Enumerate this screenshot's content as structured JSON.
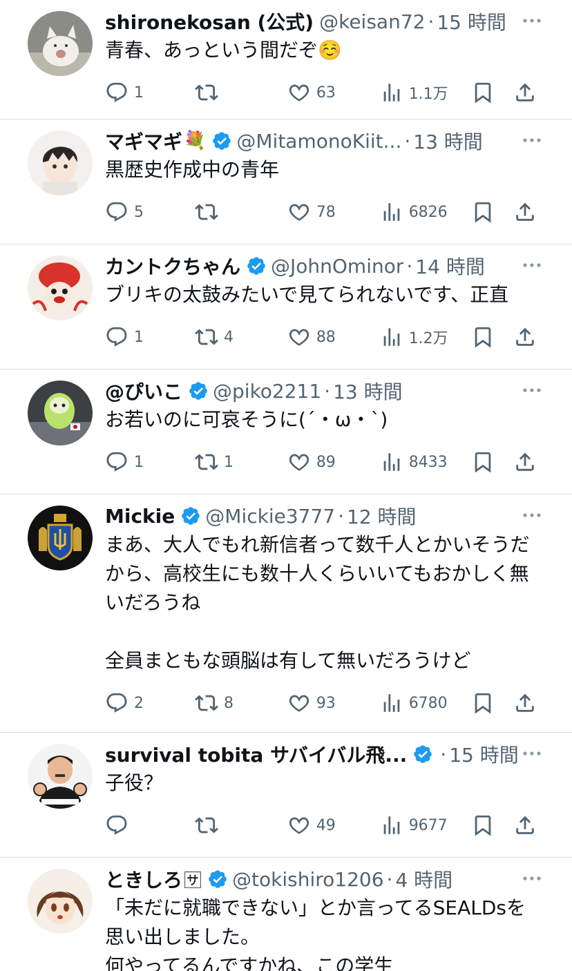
{
  "tweets": [
    {
      "name": "shironekosan (公式)",
      "name_emoji": "",
      "verified": false,
      "handle": "@keisan72",
      "time": "15 時間",
      "text": "青春、あっという間だぞ☺️",
      "replies": "1",
      "retweets": "",
      "likes": "63",
      "views": "1.1万",
      "avatar": "white-cat-avatar"
    },
    {
      "name": "マギマギ",
      "name_emoji": "💐",
      "verified": true,
      "handle": "@MitamonoKiit...",
      "time": "13 時間",
      "text": "黒歴史作成中の青年",
      "replies": "5",
      "retweets": "",
      "likes": "78",
      "views": "6826",
      "avatar": "anime-boy-avatar"
    },
    {
      "name": "カントクちゃん",
      "name_emoji": "",
      "verified": true,
      "handle": "@JohnOminor",
      "time": "14 時間",
      "text": "ブリキの太鼓みたいで見てられないです、正直",
      "replies": "1",
      "retweets": "4",
      "likes": "88",
      "views": "1.2万",
      "avatar": "red-character-avatar"
    },
    {
      "name": "@ぴいこ",
      "name_emoji": "",
      "verified": true,
      "handle": "@piko2211",
      "time": "13 時間",
      "text": "お若いのに可哀そうに(´・ω・`)",
      "replies": "1",
      "retweets": "1",
      "likes": "89",
      "views": "8433",
      "avatar": "green-parakeet-avatar"
    },
    {
      "name": "Mickie",
      "name_emoji": "",
      "verified": true,
      "handle": "@Mickie3777",
      "time": "12 時間",
      "text": "まあ、大人でもれ新信者って数千人とかいそうだから、高校生にも数十人くらいいてもおかしく無いだろうね\n\n全員まともな頭脳は有して無いだろうけど",
      "replies": "2",
      "retweets": "8",
      "likes": "93",
      "views": "6780",
      "avatar": "ukraine-coat-of-arms-avatar"
    },
    {
      "name": "survival tobita サバイバル飛...",
      "name_emoji": "",
      "verified": true,
      "handle": "",
      "time": "15 時間",
      "text": "子役？",
      "replies": "",
      "retweets": "",
      "likes": "49",
      "views": "9677",
      "avatar": "cartoon-man-avatar"
    },
    {
      "name": "ときしろ",
      "name_emoji": "🈂",
      "verified": true,
      "handle": "@tokishiro1206",
      "time": "4 時間",
      "text": "「未だに就職できない」とか言ってるSEALDsを思い出しました。\n何やってるんですかね、この学生",
      "replies": "",
      "retweets": "",
      "likes": "",
      "views": "",
      "avatar": "anime-girl-avatar"
    }
  ],
  "dot": "·",
  "more_glyph": "···",
  "colors": {
    "verified": "#1d9bf0",
    "secondary": "#536471",
    "divider": "#dadde0"
  }
}
